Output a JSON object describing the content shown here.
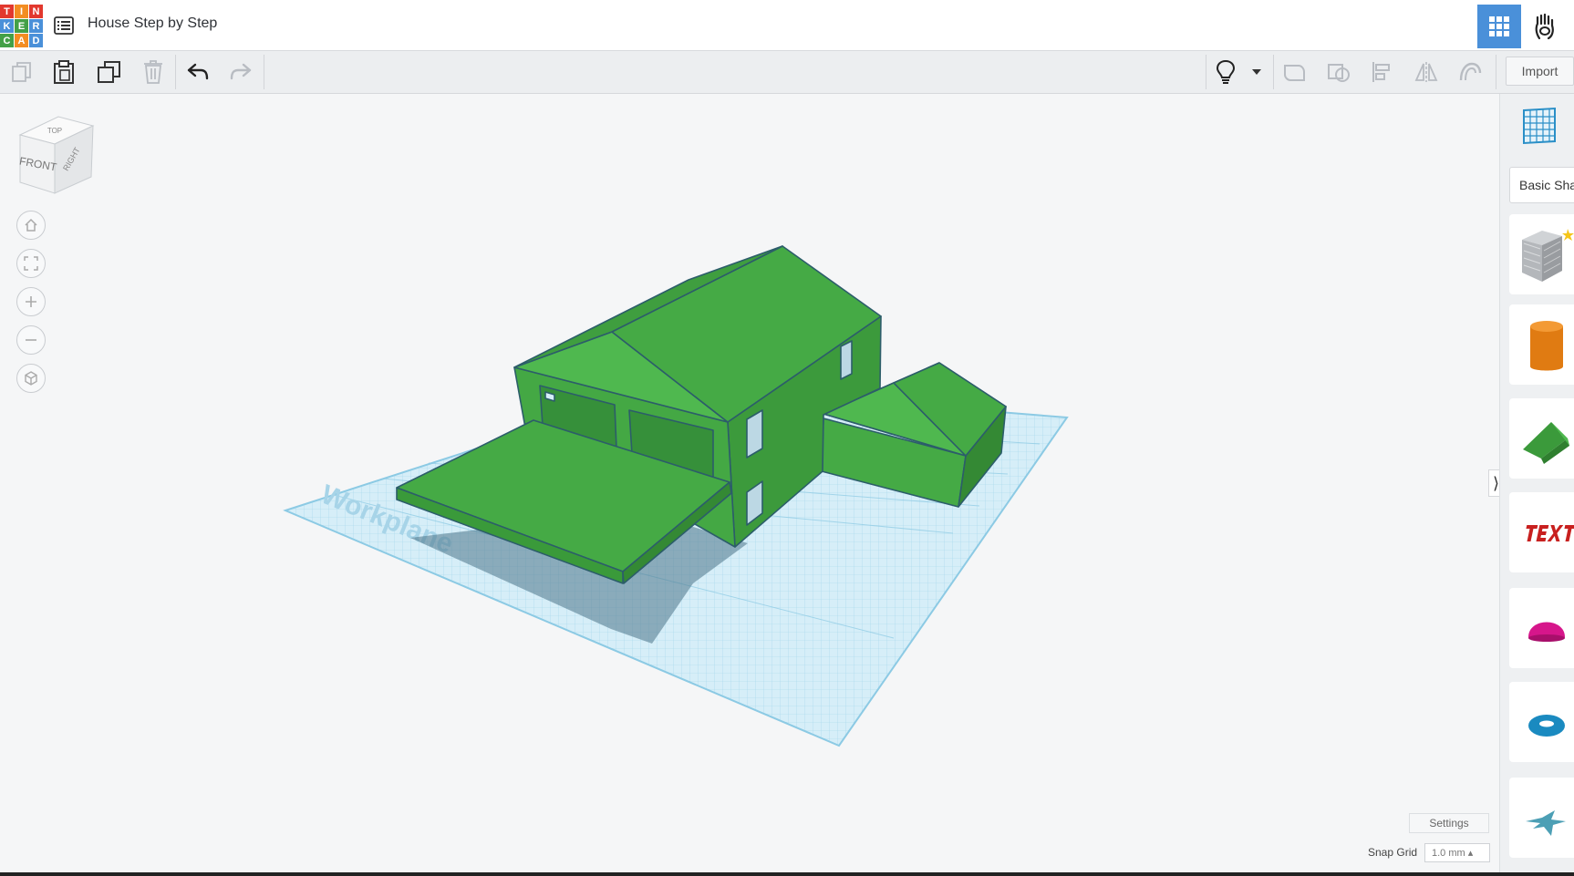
{
  "app": {
    "logo_letters": [
      "T",
      "I",
      "N",
      "K",
      "E",
      "R",
      "C",
      "A",
      "D"
    ],
    "logo_colors": [
      "#e2382e",
      "#f38d22",
      "#e2382e",
      "#4a90d9",
      "#43a047",
      "#4a90d9",
      "#43a047",
      "#f38d22",
      "#4a90d9"
    ],
    "design_title": "House Step by Step"
  },
  "toolbar": {
    "import_label": "Import",
    "buttons": [
      "copy",
      "paste",
      "duplicate",
      "delete",
      "undo",
      "redo",
      "notes",
      "notes-dropdown",
      "group",
      "ungroup",
      "align",
      "mirror",
      "workplane-magnet"
    ]
  },
  "viewcube": {
    "top": "TOP",
    "front": "FRONT",
    "right": "RIGHT"
  },
  "workplane": {
    "label": "Workplane"
  },
  "scene": {
    "model_color": "#45aa45",
    "edge_color": "#2c5d6a",
    "grid_color": "#9bd4ec"
  },
  "sidebar": {
    "library": "Basic Shapes",
    "shapes": [
      "Box",
      "Cylinder",
      "Roof",
      "Text",
      "Half Sphere",
      "Torus",
      "Star"
    ]
  },
  "footer": {
    "settings_label": "Settings",
    "snap_grid_label": "Snap Grid",
    "snap_grid_value": "1.0 mm ▴"
  }
}
